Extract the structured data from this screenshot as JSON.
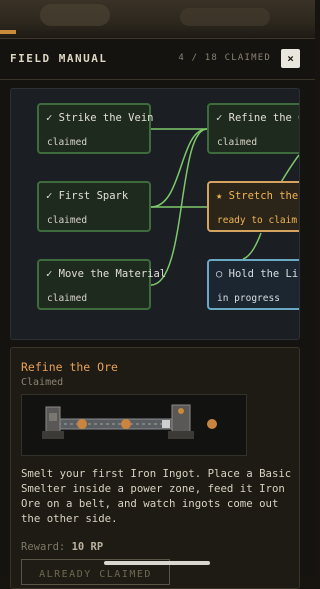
{
  "header": {
    "title": "FIELD MANUAL",
    "claimed_count": "4 / 18 CLAIMED",
    "close_label": "×"
  },
  "tree": {
    "nodes": [
      {
        "title": "✓ Strike the Vein",
        "status": "claimed",
        "state": "claimed"
      },
      {
        "title": "✓ First Spark",
        "status": "claimed",
        "state": "claimed"
      },
      {
        "title": "✓ Move the Material",
        "status": "claimed",
        "state": "claimed"
      },
      {
        "title": "✓ Refine the Ore",
        "status": "claimed",
        "state": "claimed"
      },
      {
        "title": "★ Stretch the Line",
        "status": "ready to claim",
        "state": "ready"
      },
      {
        "title": "○ Hold the Line",
        "status": "in progress",
        "state": "progress"
      }
    ],
    "link_color": "#7ec86a"
  },
  "detail": {
    "title": "Refine the Ore",
    "subtitle": "Claimed",
    "description": "Smelt your first Iron Ingot. Place a Basic Smelter inside a power zone, feed it Iron Ore on a belt, and watch ingots come out the other side.",
    "reward_label": "Reward:",
    "reward_value": "10 RP",
    "button_label": "ALREADY CLAIMED"
  },
  "colors": {
    "accent": "#e6a15a",
    "claimed_border": "#3e6b3c",
    "ready_border": "#d4a360",
    "progress_border": "#6aa9c4"
  }
}
